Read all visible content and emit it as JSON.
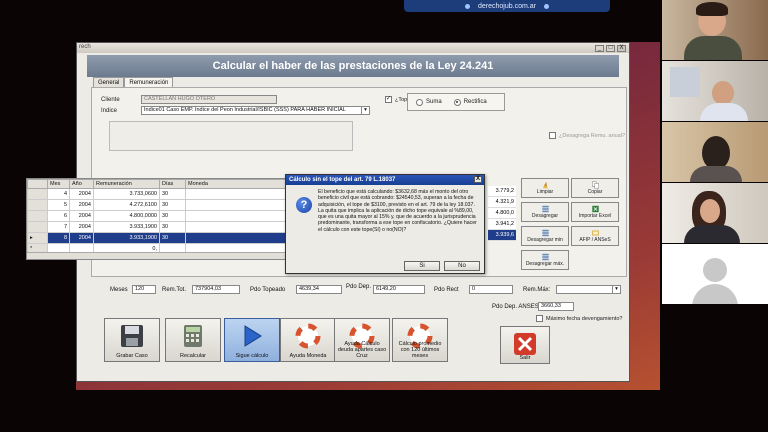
{
  "share_bar": {
    "text": "derechojub.com.ar"
  },
  "app": {
    "title_small": "rech",
    "window_buttons": [
      "_",
      "□",
      "X"
    ],
    "banner": "Calcular el haber de las prestaciones de la Ley 24.241",
    "tabs": [
      {
        "label": "General"
      },
      {
        "label": "Remuneración"
      }
    ],
    "cliente_label": "Cliente",
    "cliente_value": "CASTELLAN HUGO OTERO",
    "indice_label": "Indice",
    "indice_value": "Indice01 Caso EMP. Indice del Peon Industrial/ISBIC (SSS) PARA HABER INICIAL",
    "tope_label": "¿Tope de remu. máxima?",
    "tope_checked": "✓",
    "suma_label": "Suma",
    "rectifica_label": "Rectifica",
    "desagrega_label": "¿Desagrega Remu. anual?",
    "grid": {
      "headers": [
        "Mes",
        "Año",
        "Remuneración",
        "Días",
        "Moneda"
      ],
      "rows": [
        {
          "mes": "4",
          "anio": "2004",
          "remu": "3.733,0600",
          "dias": "30",
          "moneda": ""
        },
        {
          "mes": "5",
          "anio": "2004",
          "remu": "4.272,6100",
          "dias": "30",
          "moneda": ""
        },
        {
          "mes": "6",
          "anio": "2004",
          "remu": "4.800,0000",
          "dias": "30",
          "moneda": ""
        },
        {
          "mes": "7",
          "anio": "2004",
          "remu": "3.933,1900",
          "dias": "30",
          "moneda": ""
        },
        {
          "mes": "8",
          "anio": "2004",
          "remu": "3.933,1900",
          "dias": "30",
          "moneda": ""
        },
        {
          "mes": "",
          "anio": "",
          "remu": "0,",
          "dias": "",
          "moneda": ""
        }
      ],
      "right_values": [
        "3.779,2",
        "4.321,9",
        "4.800,0",
        "3.941,2",
        "3.939,6"
      ]
    },
    "side_buttons": [
      {
        "label": "Limpiar"
      },
      {
        "label": "Copiar"
      },
      {
        "label": "Desagregar"
      },
      {
        "label": "Importar Excel"
      },
      {
        "label": "Desagregar min"
      },
      {
        "label": "AFIP / ANSeS"
      },
      {
        "label": "Desagregar máx."
      }
    ],
    "bottom": {
      "meses_label": "Meses",
      "meses_value": "120",
      "remtot_label": "Rem.Tot.",
      "remtot_value": "737904,03",
      "pdo_topeado_label": "Pdo Topeado",
      "pdo_topeado_value": "4639,34",
      "pdo_dep_label": "Pdo Dep.",
      "pdo_dep_value": "6149,20",
      "pdo_rect_label": "Pdo Rect",
      "pdo_rect_value": "0",
      "rem_max_label": "Rem.Máx:",
      "rem_max_value": "",
      "pdo_anses_label": "Pdo Dep. ANSES",
      "pdo_anses_value": "3660,33",
      "max_fecha_label": "Máximo fecha devengamiento?"
    },
    "big_buttons": [
      {
        "label": "Grabar Caso"
      },
      {
        "label": "Recalcular"
      },
      {
        "label": "Sigue cálculo"
      },
      {
        "label": "Ayuda Moneda"
      },
      {
        "label": "Ayuda Cálculo deuda apartes caso Cruz"
      },
      {
        "label": "Cálculo promedio con 120 últimos meses"
      },
      {
        "label": "Salir"
      }
    ]
  },
  "dialog": {
    "title": "Cálculo sin el tope del art. 79 L.18037",
    "message": "El beneficio que está calculando: $3632,68 más el monto del otro beneficio civil que está cobrando: $24540,53, superan a la fecha de adquisición, el tope de $3100, previsto en el art. 79 de la ley 18.037. La quita que implica la aplicación de dicho tope equivale al %89,00, que es una quita mayor al 15% y, que de acuerdo a la jurisprudencia predominante, transforma a ese tope en confiscatorio. ¿Quiere hacer el cálculo con este tope(SI) o no(NO)?",
    "yes_label": "Si",
    "no_label": "No",
    "close_label": "X",
    "icon_char": "?"
  }
}
